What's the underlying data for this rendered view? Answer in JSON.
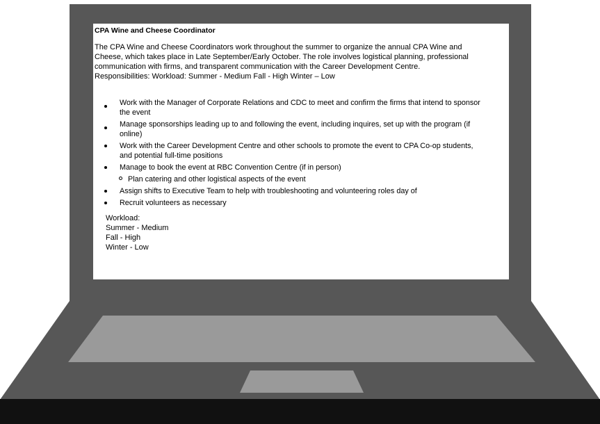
{
  "document": {
    "title": "CPA Wine and Cheese Coordinator",
    "intro_lines": [
      "The CPA Wine and Cheese Coordinators work throughout the summer to organize the annual CPA Wine and",
      "Cheese, which takes place in Late September/Early October. The role involves logistical planning, professional",
      "communication with firms, and transparent communication with the Career Development Centre.",
      "Responsibilities: Workload: Summer - Medium Fall - High Winter – Low"
    ],
    "bullets": [
      "Work with the Manager of Corporate Relations and CDC to meet and confirm the firms that intend to sponsor the event",
      "Manage sponsorships leading up to and following the event, including inquires, set up with the program (if online)",
      "Work with the Career Development Centre and other schools to promote the event to CPA Co-op students, and potential full-time positions",
      "Manage to book the event at RBC Convention Centre (if in person)"
    ],
    "sub_bullet": "Plan catering and other logistical aspects of the event",
    "bullets_after": [
      "Assign shifts to Executive Team to help with troubleshooting and volunteering roles day of",
      "Recruit volunteers as necessary"
    ],
    "workload": {
      "heading": "Workload:",
      "summer": "Summer - Medium",
      "fall": "Fall - High",
      "winter": "Winter - Low"
    }
  },
  "colors": {
    "laptop_lid": "#575757",
    "laptop_base": "#575757",
    "keyboard_area": "#9a9a9a",
    "touchpad": "#9a9a9a",
    "base_edge": "#111111"
  }
}
